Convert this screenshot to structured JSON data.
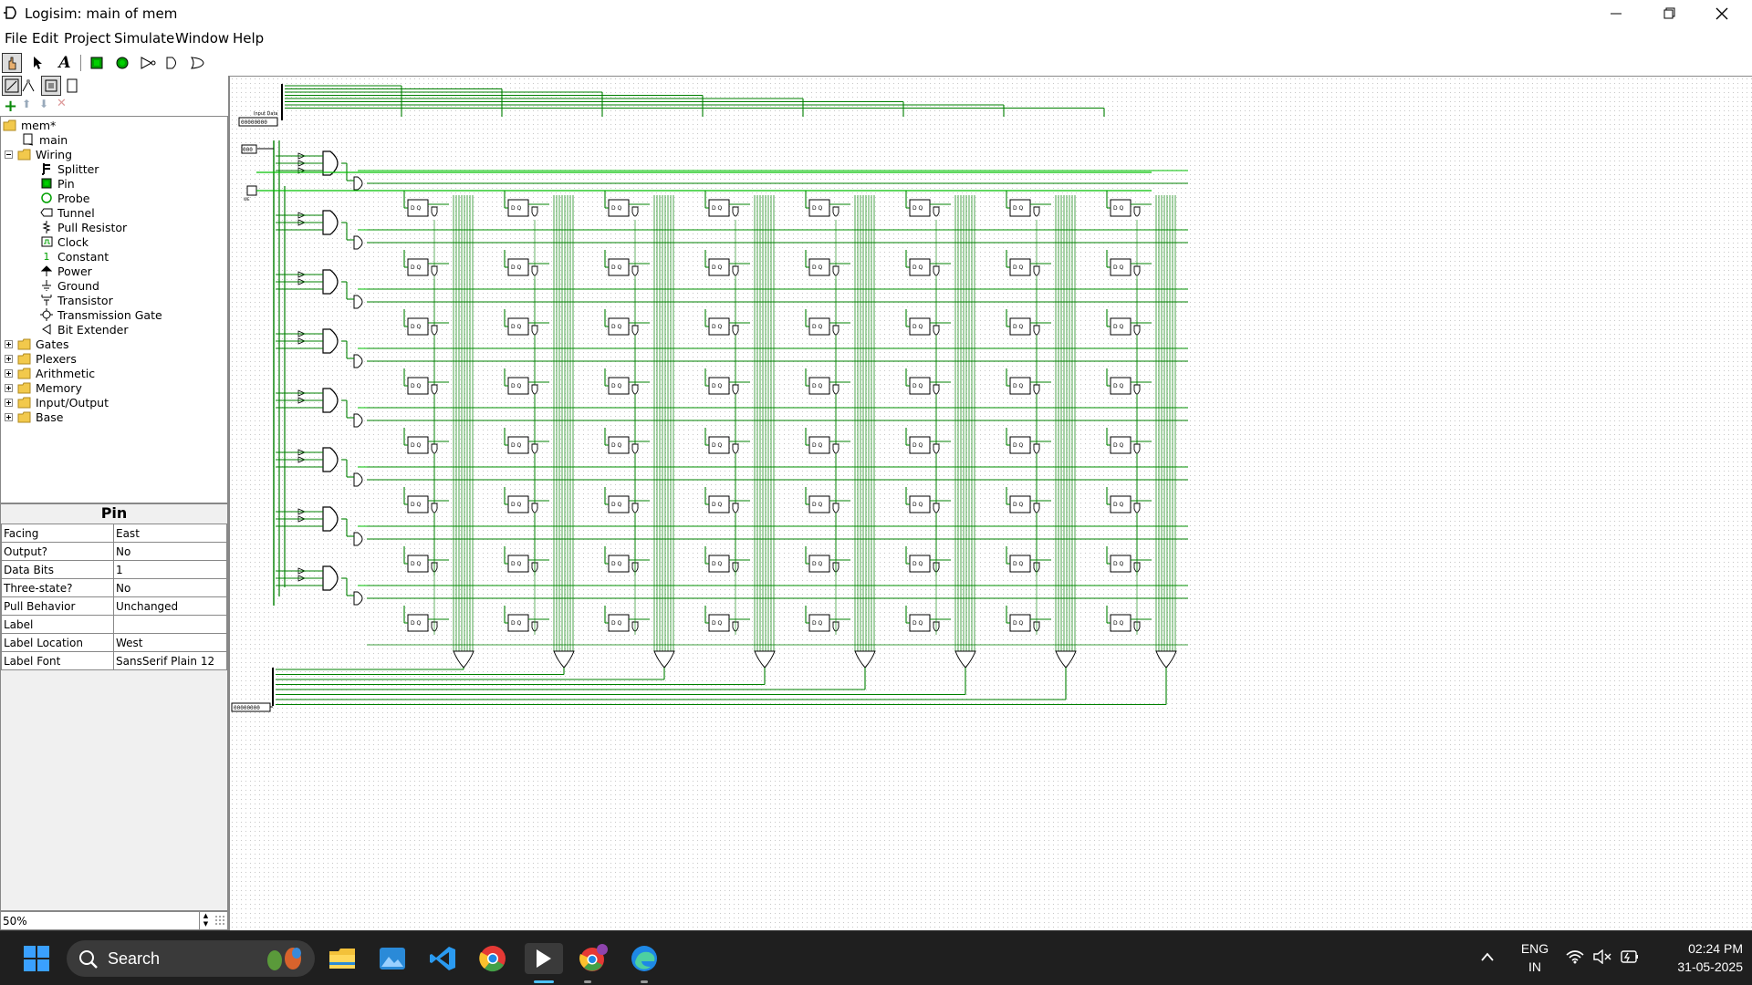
{
  "window": {
    "title": "Logisim: main of mem",
    "controls": [
      "minimize-icon",
      "maximize-icon",
      "close-icon"
    ]
  },
  "menu": [
    "File",
    "Edit",
    "Project",
    "Simulate",
    "Window",
    "Help"
  ],
  "toolbar": {
    "tools": [
      "poke-tool-icon",
      "select-tool-icon",
      "text-tool-icon",
      "input-pin-icon",
      "output-pin-icon",
      "not-gate-icon",
      "and-gate-icon",
      "or-gate-icon"
    ]
  },
  "explorer": {
    "project": "mem*",
    "main": "main",
    "wiring": {
      "label": "Wiring",
      "items": [
        "Splitter",
        "Pin",
        "Probe",
        "Tunnel",
        "Pull Resistor",
        "Clock",
        "Constant",
        "Power",
        "Ground",
        "Transistor",
        "Transmission Gate",
        "Bit Extender"
      ]
    },
    "libraries": [
      "Gates",
      "Plexers",
      "Arithmetic",
      "Memory",
      "Input/Output",
      "Base"
    ]
  },
  "attributes": {
    "title": "Pin",
    "rows": [
      {
        "name": "Facing",
        "value": "East"
      },
      {
        "name": "Output?",
        "value": "No"
      },
      {
        "name": "Data Bits",
        "value": "1"
      },
      {
        "name": "Three-state?",
        "value": "No"
      },
      {
        "name": "Pull Behavior",
        "value": "Unchanged"
      },
      {
        "name": "Label",
        "value": ""
      },
      {
        "name": "Label Location",
        "value": "West"
      },
      {
        "name": "Label Font",
        "value": "SansSerif Plain 12"
      }
    ]
  },
  "zoom": "50%",
  "canvas": {
    "input_label": "Input Data",
    "input_pin_value": "00000000",
    "addr_pin_value": "000",
    "we_label": "WE",
    "output_pin_value": "00000000",
    "cell_label": "D Q",
    "grid_rows": 8,
    "grid_cols": 8,
    "colors": {
      "wire": "#008000",
      "wire_light": "#00c000",
      "component": "#000000"
    }
  },
  "taskbar": {
    "search_placeholder": "Search",
    "lang_top": "ENG",
    "lang_bottom": "IN",
    "time": "02:24 PM",
    "date": "31-05-2025"
  }
}
